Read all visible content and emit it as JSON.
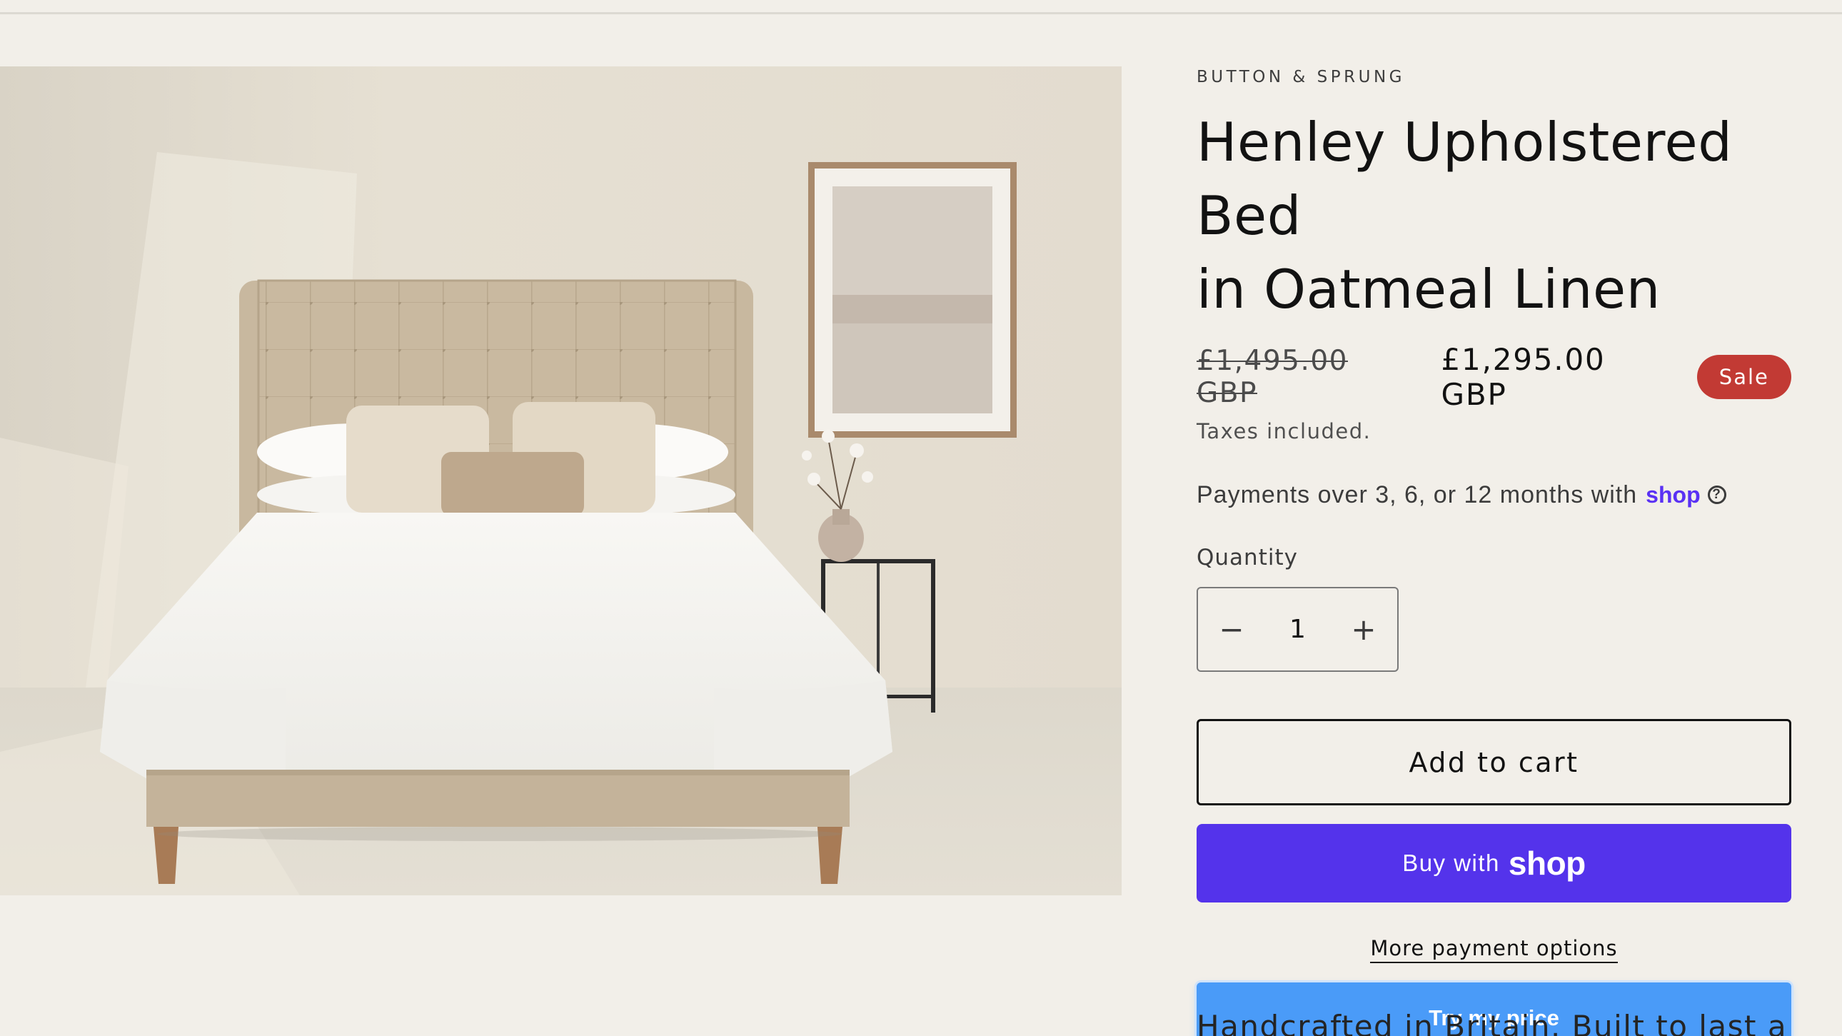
{
  "product": {
    "vendor": "BUTTON & SPRUNG",
    "title_line1": "Henley Upholstered Bed",
    "title_line2": "in Oatmeal Linen",
    "compare_price": "£1,495.00 GBP",
    "sale_price": "£1,295.00 GBP",
    "sale_badge": "Sale",
    "taxes_note": "Taxes included.",
    "description_preview": "Handcrafted in Britain. Built to last a"
  },
  "installments": {
    "text": "Payments over 3, 6, or 12 months with",
    "brand": "shop",
    "help_glyph": "?"
  },
  "quantity": {
    "label": "Quantity",
    "value": "1",
    "decrement_glyph": "−",
    "increment_glyph": "+"
  },
  "actions": {
    "add_to_cart": "Add to cart",
    "buy_with": "Buy with",
    "buy_brand": "shop",
    "more_payment_options": "More payment options",
    "try_my_price": "Try my price"
  },
  "colors": {
    "page_background": "#f2efe9",
    "sale_badge": "#c23a34",
    "shop_purple": "#5433eb",
    "try_price_blue": "#4a9bf8"
  },
  "icons": {
    "help": "question-circle-icon",
    "minus": "minus-icon",
    "plus": "plus-icon"
  }
}
